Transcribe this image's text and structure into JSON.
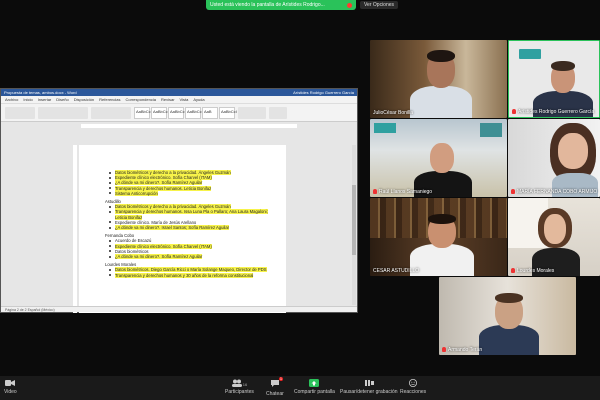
{
  "banner": {
    "text": "Usted está viendo la pantalla de Arístides Rodrigo...",
    "view_options": "Ver Opciones"
  },
  "word": {
    "title": "Propuesta de temas, ambos.docx - Word",
    "user": "Arístides Rodrigo Guerrero García",
    "menu": [
      "Archivo",
      "Inicio",
      "Insertar",
      "Diseño",
      "Disposición",
      "Referencias",
      "Correspondencia",
      "Revisar",
      "Vista",
      "Ayuda"
    ],
    "styles": [
      "AaBbCcI",
      "AaBbCcI",
      "AaBbCc",
      "AaBbCc",
      "AaB",
      "AaBbCcI"
    ],
    "sections": [
      {
        "name": "",
        "items": [
          {
            "text": "Datos biométricos y derecho a la privacidad. Ángeles Guzmán",
            "hl": true
          },
          {
            "text": "Expediente clínico electrónico. Sofía Charvel (ITAM)",
            "hl": true
          },
          {
            "text": "¿A dónde va mi dinero?. Sofía Ramírez Aguilar",
            "hl": true
          },
          {
            "text": "Transparencia y derechos humanos. Leticia Bonifaz",
            "hl": true
          },
          {
            "text": "Sistema Anticorrupción",
            "hl": true
          }
        ]
      },
      {
        "name": "Astudillo",
        "items": [
          {
            "text": "Datos biométricos y derecho a la privacidad. Ángeles Guzmán",
            "hl": true
          },
          {
            "text": "Transparencia y derechos humanos. Issa Luna Pla o Pallaro; Ana Laura Magaloni; Leticia Bonifaz",
            "hl": true
          },
          {
            "text": "Expediente clínico. María de Jesús Arellano",
            "hl": false
          },
          {
            "text": "¿A dónde va mi dinero?. Israel Santos; Sofía Ramírez Aguilar",
            "hl": true
          }
        ]
      },
      {
        "name": "Fernanda Cobo",
        "items": [
          {
            "text": "Acuerdo de Escazú",
            "hl": false
          },
          {
            "text": "Expediente clínico electrónico. Sofía Charvel (ITAM)",
            "hl": true
          },
          {
            "text": "Datos biométricos",
            "hl": false
          },
          {
            "text": "¿A dónde va mi dinero?. Sofía Ramírez Aguilar",
            "hl": true
          }
        ]
      },
      {
        "name": "Lourdes Morales",
        "items": [
          {
            "text": "Datos biométricos. Diego García Ricci o María Solange Maqueo, Director de PDS",
            "hl": true
          },
          {
            "text": "Transparencia y derechos humanos y 30 años de la reforma constitucional",
            "hl": true
          }
        ]
      }
    ],
    "status": "Página 2 de 2   Español (México)"
  },
  "participants": [
    {
      "name": "JulioCésar Bonilla",
      "muted": false
    },
    {
      "name": "Arístides Rodrigo Guerrero García",
      "muted": true
    },
    {
      "name": "Raúl Llanos Samaniego",
      "muted": true
    },
    {
      "name": "MARÍA FERNANDA COBO ARMIJO",
      "muted": true
    },
    {
      "name": "CESAR ASTUDILLO",
      "muted": false
    },
    {
      "name": "Lourdes Morales",
      "muted": true
    },
    {
      "name": "Armando Terán",
      "muted": true
    }
  ],
  "toolbar": {
    "video": "Video",
    "participants": "Participantes",
    "participants_count": "16",
    "chat": "Chatear",
    "chat_badge": "1",
    "share": "Compartir pantalla",
    "record": "Pausar/detener grabación",
    "reactions": "Reacciones"
  },
  "colors": {
    "share_green": "#2ac25a",
    "highlight": "#f7f34a",
    "word_blue": "#2b579a"
  }
}
